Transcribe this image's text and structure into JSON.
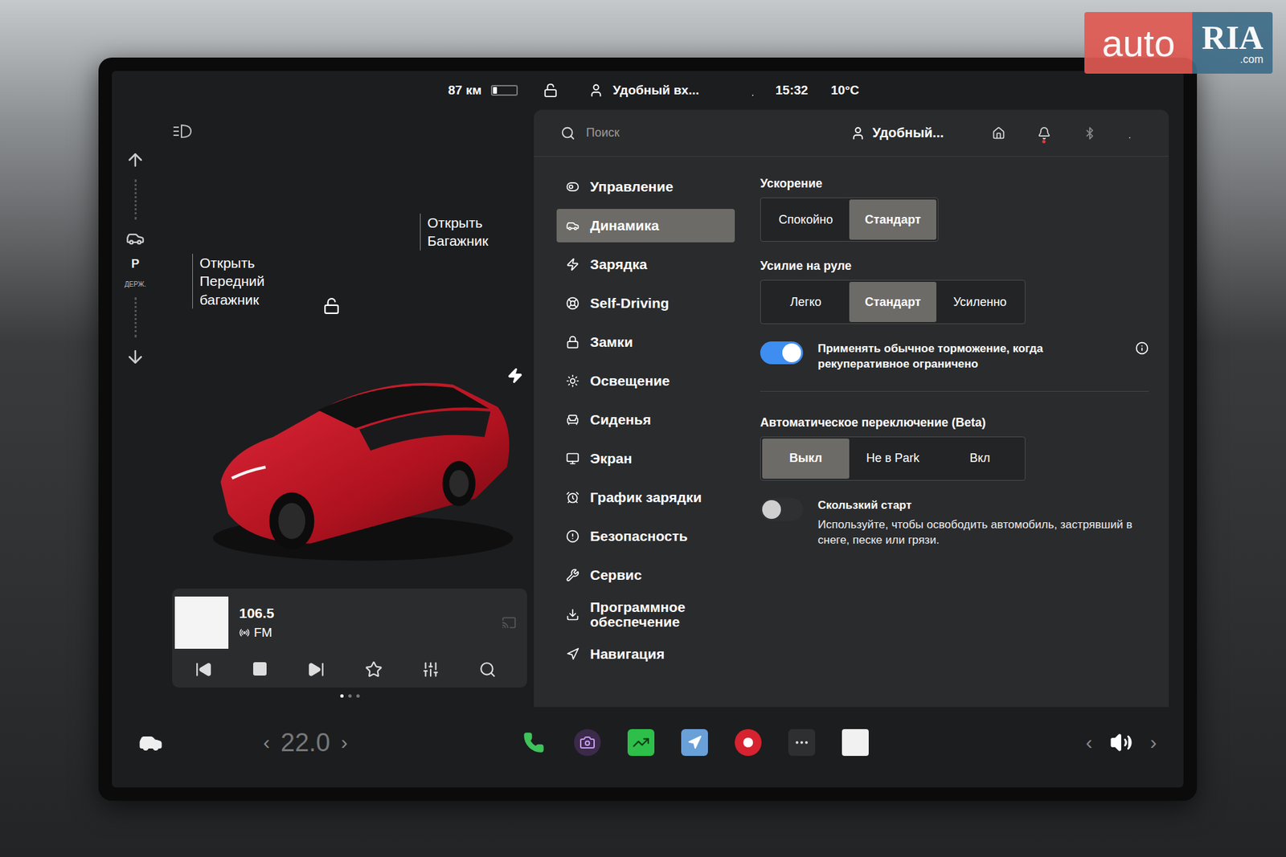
{
  "watermark": {
    "brand": "auto",
    "logo": "RIA",
    "suffix": ".com"
  },
  "status_bar": {
    "range": "87 км",
    "battery_level": 0.18,
    "profile": "Удобный вх...",
    "time": "15:32",
    "temperature": "10°C"
  },
  "gear": {
    "label": "P",
    "sub": "ДЕРЖ."
  },
  "car_panel": {
    "front_trunk": [
      "Открыть",
      "Передний",
      "багажник"
    ],
    "rear_trunk": [
      "Открыть",
      "Багажник"
    ]
  },
  "media": {
    "station": "106.5",
    "band": "FM",
    "page_dots": [
      true,
      false,
      false
    ]
  },
  "settings_header": {
    "search_placeholder": "Поиск",
    "profile": "Удобный..."
  },
  "menu": [
    {
      "label": "Управление",
      "selected": false
    },
    {
      "label": "Динамика",
      "selected": true
    },
    {
      "label": "Зарядка",
      "selected": false
    },
    {
      "label": "Self-Driving",
      "selected": false
    },
    {
      "label": "Замки",
      "selected": false
    },
    {
      "label": "Освещение",
      "selected": false
    },
    {
      "label": "Сиденья",
      "selected": false
    },
    {
      "label": "Экран",
      "selected": false
    },
    {
      "label": "График зарядки",
      "selected": false
    },
    {
      "label": "Безопасность",
      "selected": false
    },
    {
      "label": "Сервис",
      "selected": false
    },
    {
      "label": "Программное обеспечение",
      "selected": false
    },
    {
      "label": "Навигация",
      "selected": false
    }
  ],
  "sections": [
    {
      "kind": "segmented",
      "title": "Ускорение",
      "options": [
        {
          "label": "Спокойно",
          "selected": false
        },
        {
          "label": "Стандарт",
          "selected": true
        }
      ]
    },
    {
      "kind": "segmented",
      "title": "Усилие на руле",
      "options": [
        {
          "label": "Легко",
          "selected": false
        },
        {
          "label": "Стандарт",
          "selected": true
        },
        {
          "label": "Усиленно",
          "selected": false
        }
      ]
    },
    {
      "kind": "toggle",
      "title": "Применять обычное торможение, когда рекуперативное ограничено",
      "description": "",
      "on": true,
      "info": true
    },
    {
      "kind": "divider"
    },
    {
      "kind": "segmented",
      "title": "Автоматическое переключение (Beta)",
      "options": [
        {
          "label": "Выкл",
          "selected": true
        },
        {
          "label": "Не в Park",
          "selected": false
        },
        {
          "label": "Вкл",
          "selected": false
        }
      ]
    },
    {
      "kind": "toggle",
      "title": "Скользкий старт",
      "description": "Используйте, чтобы освободить автомобиль, застрявший в снеге, песке или грязи.",
      "on": false,
      "info": false
    }
  ],
  "bottom_bar": {
    "temperature": "22.0",
    "temp_left": "‹",
    "temp_right": "›",
    "vol_left": "‹",
    "vol_right": "›"
  }
}
